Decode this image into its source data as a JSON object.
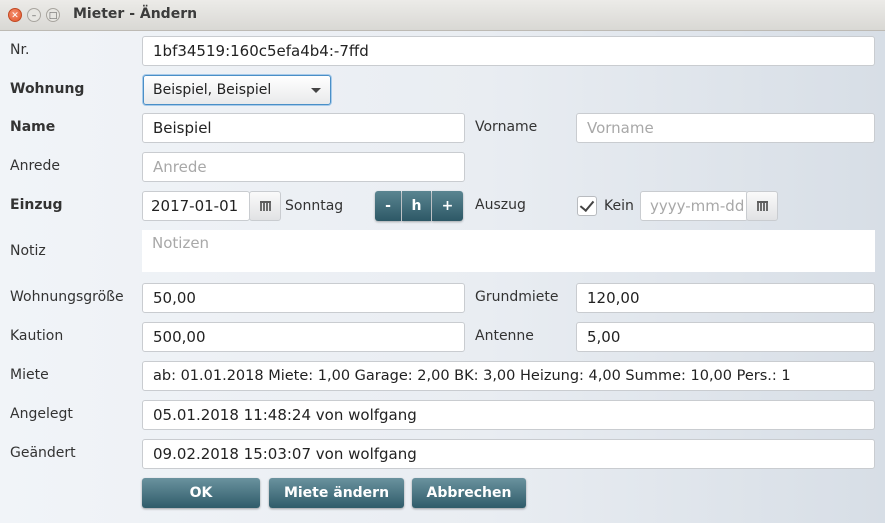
{
  "window": {
    "title": "Mieter - Ändern",
    "close_glyph": "✕",
    "min_glyph": "–",
    "max_glyph": "□"
  },
  "form": {
    "nr": {
      "label": "Nr.",
      "value": "1bf34519:160c5efa4b4:-7ffd"
    },
    "wohnung": {
      "label": "Wohnung",
      "selected": "Beispiel, Beispiel"
    },
    "name": {
      "label": "Name",
      "value": "Beispiel"
    },
    "vorname": {
      "label": "Vorname",
      "placeholder": "Vorname"
    },
    "anrede": {
      "label": "Anrede",
      "placeholder": "Anrede"
    },
    "einzug": {
      "label": "Einzug",
      "date": "2017-01-01",
      "weekday": "Sonntag"
    },
    "day_buttons": {
      "minus": "-",
      "today": "h",
      "plus": "+"
    },
    "auszug": {
      "label": "Auszug",
      "checkbox_label": "Kein",
      "checked": true,
      "placeholder": "yyyy-mm-dd"
    },
    "notiz": {
      "label": "Notiz",
      "placeholder": "Notizen"
    },
    "wohnungsgroesse": {
      "label": "Wohnungsgröße",
      "value": "50,00"
    },
    "grundmiete": {
      "label": "Grundmiete",
      "value": "120,00"
    },
    "kaution": {
      "label": "Kaution",
      "value": "500,00"
    },
    "antenne": {
      "label": "Antenne",
      "value": "5,00"
    },
    "miete": {
      "label": "Miete",
      "value": "ab: 01.01.2018  Miete: 1,00  Garage: 2,00  BK: 3,00  Heizung: 4,00  Summe: 10,00  Pers.: 1"
    },
    "angelegt": {
      "label": "Angelegt",
      "value": "05.01.2018 11:48:24 von wolfgang"
    },
    "geaendert": {
      "label": "Geändert",
      "value": "09.02.2018 15:03:07 von wolfgang"
    }
  },
  "actions": {
    "ok": "OK",
    "miete_aendern": "Miete ändern",
    "abbrechen": "Abbrechen"
  },
  "icons": {
    "calendar": "calendar-icon",
    "dropdown": "chevron-down-icon",
    "check": "check-icon"
  },
  "colors": {
    "accent": "#2d5866",
    "focus": "#4a8fc7"
  }
}
